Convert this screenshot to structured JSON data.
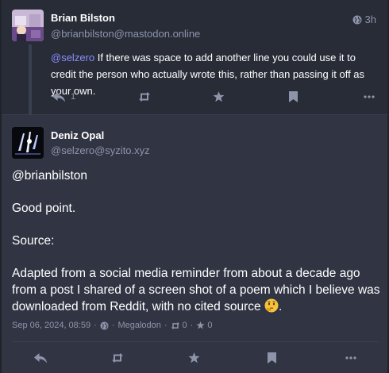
{
  "reply_status": {
    "display_name": "Brian Bilston",
    "account": "@brianbilston@mastodon.online",
    "time": "3h",
    "mention": "@selzero",
    "text": " If there was space to add another line you could use it to credit the person who actually wrote this, rather than passing it off as your own.",
    "reply_count": "1"
  },
  "detail_status": {
    "display_name": "Deniz Opal",
    "account": "@selzero@syzito.xyz",
    "paragraphs": [
      "@brianbilston",
      "Good point.",
      "Source:"
    ],
    "last_paragraph": "Adapted from a social media reminder from about a decade ago from a post I shared of a screen shot of a poem which I believe was downloaded from Reddit, with no cited source",
    "last_paragraph_end": ".",
    "date": "Sep 06, 2024, 08:59",
    "app": "Megalodon",
    "boost_count": "0",
    "favourite_count": "0"
  },
  "colors": {
    "background": "#282c37",
    "detail_background": "#313543",
    "secondary_text": "#8e95ab",
    "mention": "#8c8dff"
  }
}
